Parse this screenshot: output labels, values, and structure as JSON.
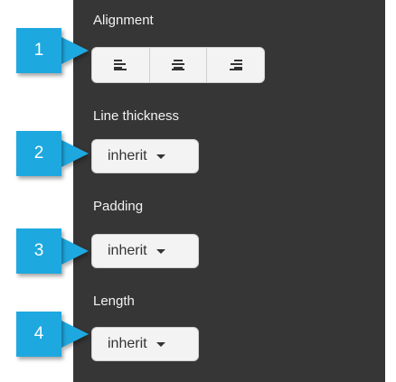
{
  "sections": {
    "alignment": {
      "label": "Alignment",
      "buttons": [
        {
          "icon": "align-left-icon"
        },
        {
          "icon": "align-center-icon"
        },
        {
          "icon": "align-right-icon"
        }
      ]
    },
    "line_thickness": {
      "label": "Line thickness",
      "value": "inherit"
    },
    "padding": {
      "label": "Padding",
      "value": "inherit"
    },
    "length": {
      "label": "Length",
      "value": "inherit"
    }
  },
  "callouts": [
    "1",
    "2",
    "3",
    "4"
  ],
  "colors": {
    "panel": "#363636",
    "callout": "#1ea8e0",
    "control_bg": "#f3f3f3",
    "label_text": "#f2f2f2"
  }
}
